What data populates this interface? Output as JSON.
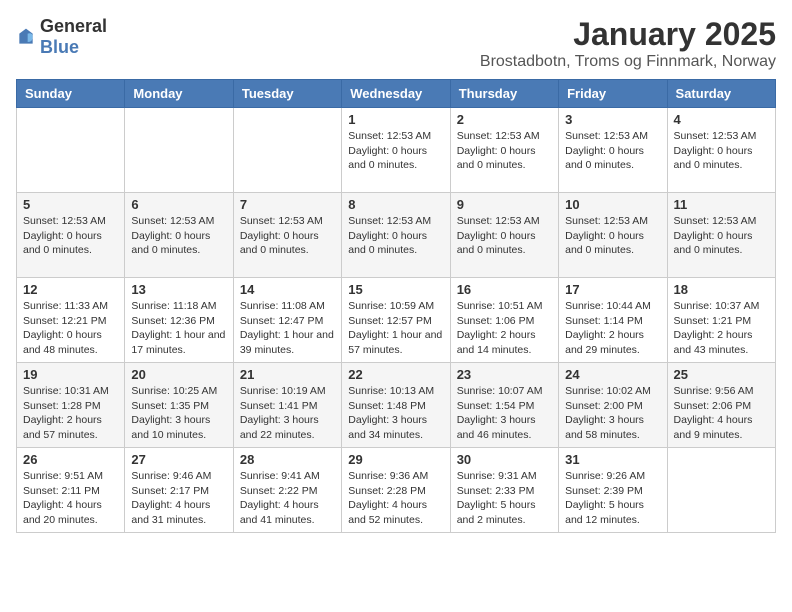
{
  "header": {
    "logo_general": "General",
    "logo_blue": "Blue",
    "title": "January 2025",
    "subtitle": "Brostadbotn, Troms og Finnmark, Norway"
  },
  "columns": [
    "Sunday",
    "Monday",
    "Tuesday",
    "Wednesday",
    "Thursday",
    "Friday",
    "Saturday"
  ],
  "weeks": [
    [
      {
        "day": "",
        "info": ""
      },
      {
        "day": "",
        "info": ""
      },
      {
        "day": "",
        "info": ""
      },
      {
        "day": "1",
        "info": "Sunset: 12:53 AM\nDaylight: 0 hours and 0 minutes."
      },
      {
        "day": "2",
        "info": "Sunset: 12:53 AM\nDaylight: 0 hours and 0 minutes."
      },
      {
        "day": "3",
        "info": "Sunset: 12:53 AM\nDaylight: 0 hours and 0 minutes."
      },
      {
        "day": "4",
        "info": "Sunset: 12:53 AM\nDaylight: 0 hours and 0 minutes."
      }
    ],
    [
      {
        "day": "5",
        "info": "Sunset: 12:53 AM\nDaylight: 0 hours and 0 minutes."
      },
      {
        "day": "6",
        "info": "Sunset: 12:53 AM\nDaylight: 0 hours and 0 minutes."
      },
      {
        "day": "7",
        "info": "Sunset: 12:53 AM\nDaylight: 0 hours and 0 minutes."
      },
      {
        "day": "8",
        "info": "Sunset: 12:53 AM\nDaylight: 0 hours and 0 minutes."
      },
      {
        "day": "9",
        "info": "Sunset: 12:53 AM\nDaylight: 0 hours and 0 minutes."
      },
      {
        "day": "10",
        "info": "Sunset: 12:53 AM\nDaylight: 0 hours and 0 minutes."
      },
      {
        "day": "11",
        "info": "Sunset: 12:53 AM\nDaylight: 0 hours and 0 minutes."
      }
    ],
    [
      {
        "day": "12",
        "info": "Sunrise: 11:33 AM\nSunset: 12:21 PM\nDaylight: 0 hours and 48 minutes."
      },
      {
        "day": "13",
        "info": "Sunrise: 11:18 AM\nSunset: 12:36 PM\nDaylight: 1 hour and 17 minutes."
      },
      {
        "day": "14",
        "info": "Sunrise: 11:08 AM\nSunset: 12:47 PM\nDaylight: 1 hour and 39 minutes."
      },
      {
        "day": "15",
        "info": "Sunrise: 10:59 AM\nSunset: 12:57 PM\nDaylight: 1 hour and 57 minutes."
      },
      {
        "day": "16",
        "info": "Sunrise: 10:51 AM\nSunset: 1:06 PM\nDaylight: 2 hours and 14 minutes."
      },
      {
        "day": "17",
        "info": "Sunrise: 10:44 AM\nSunset: 1:14 PM\nDaylight: 2 hours and 29 minutes."
      },
      {
        "day": "18",
        "info": "Sunrise: 10:37 AM\nSunset: 1:21 PM\nDaylight: 2 hours and 43 minutes."
      }
    ],
    [
      {
        "day": "19",
        "info": "Sunrise: 10:31 AM\nSunset: 1:28 PM\nDaylight: 2 hours and 57 minutes."
      },
      {
        "day": "20",
        "info": "Sunrise: 10:25 AM\nSunset: 1:35 PM\nDaylight: 3 hours and 10 minutes."
      },
      {
        "day": "21",
        "info": "Sunrise: 10:19 AM\nSunset: 1:41 PM\nDaylight: 3 hours and 22 minutes."
      },
      {
        "day": "22",
        "info": "Sunrise: 10:13 AM\nSunset: 1:48 PM\nDaylight: 3 hours and 34 minutes."
      },
      {
        "day": "23",
        "info": "Sunrise: 10:07 AM\nSunset: 1:54 PM\nDaylight: 3 hours and 46 minutes."
      },
      {
        "day": "24",
        "info": "Sunrise: 10:02 AM\nSunset: 2:00 PM\nDaylight: 3 hours and 58 minutes."
      },
      {
        "day": "25",
        "info": "Sunrise: 9:56 AM\nSunset: 2:06 PM\nDaylight: 4 hours and 9 minutes."
      }
    ],
    [
      {
        "day": "26",
        "info": "Sunrise: 9:51 AM\nSunset: 2:11 PM\nDaylight: 4 hours and 20 minutes."
      },
      {
        "day": "27",
        "info": "Sunrise: 9:46 AM\nSunset: 2:17 PM\nDaylight: 4 hours and 31 minutes."
      },
      {
        "day": "28",
        "info": "Sunrise: 9:41 AM\nSunset: 2:22 PM\nDaylight: 4 hours and 41 minutes."
      },
      {
        "day": "29",
        "info": "Sunrise: 9:36 AM\nSunset: 2:28 PM\nDaylight: 4 hours and 52 minutes."
      },
      {
        "day": "30",
        "info": "Sunrise: 9:31 AM\nSunset: 2:33 PM\nDaylight: 5 hours and 2 minutes."
      },
      {
        "day": "31",
        "info": "Sunrise: 9:26 AM\nSunset: 2:39 PM\nDaylight: 5 hours and 12 minutes."
      },
      {
        "day": "",
        "info": ""
      }
    ]
  ]
}
